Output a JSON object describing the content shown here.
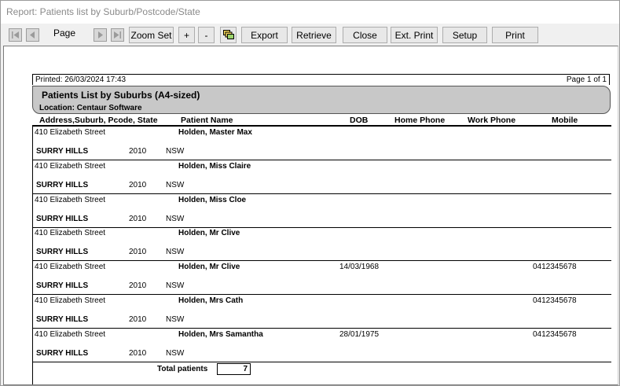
{
  "window": {
    "title": "Report: Patients list by Suburb/Postcode/State"
  },
  "toolbar": {
    "page_label": "Page",
    "zoom_set": "Zoom Set",
    "zoom_in": "+",
    "zoom_out": "-",
    "export": "Export",
    "retrieve": "Retrieve",
    "close": "Close",
    "ext_print": "Ext. Print",
    "setup": "Setup",
    "print": "Print"
  },
  "report": {
    "printed": "Printed: 26/03/2024 17:43",
    "page_of": "Page 1 of 1",
    "title": "Patients List  by  Suburbs (A4-sized)",
    "location": "Location: Centaur Software",
    "columns": {
      "address": "Address,Suburb, Pcode, State",
      "patient": "Patient Name",
      "dob": "DOB",
      "home": "Home Phone",
      "work": "Work Phone",
      "mobile": "Mobile"
    },
    "rows": [
      {
        "address": "410 Elizabeth Street",
        "name": "Holden, Master Max",
        "dob": "",
        "mobile": "",
        "suburb": "SURRY HILLS",
        "pcode": "2010",
        "state": "NSW"
      },
      {
        "address": "410 Elizabeth Street",
        "name": "Holden, Miss Claire",
        "dob": "",
        "mobile": "",
        "suburb": "SURRY HILLS",
        "pcode": "2010",
        "state": "NSW"
      },
      {
        "address": "410 Elizabeth Street",
        "name": "Holden, Miss Cloe",
        "dob": "",
        "mobile": "",
        "suburb": "SURRY HILLS",
        "pcode": "2010",
        "state": "NSW"
      },
      {
        "address": "410 Elizabeth Street",
        "name": "Holden, Mr Clive",
        "dob": "",
        "mobile": "",
        "suburb": "SURRY HILLS",
        "pcode": "2010",
        "state": "NSW"
      },
      {
        "address": "410 Elizabeth Street",
        "name": "Holden, Mr Clive",
        "dob": "14/03/1968",
        "mobile": "0412345678",
        "suburb": "SURRY HILLS",
        "pcode": "2010",
        "state": "NSW"
      },
      {
        "address": "410 Elizabeth Street",
        "name": "Holden, Mrs Cath",
        "dob": "",
        "mobile": "0412345678",
        "suburb": "SURRY HILLS",
        "pcode": "2010",
        "state": "NSW"
      },
      {
        "address": "410 Elizabeth Street",
        "name": "Holden, Mrs Samantha",
        "dob": "28/01/1975",
        "mobile": "0412345678",
        "suburb": "SURRY HILLS",
        "pcode": "2010",
        "state": "NSW"
      }
    ],
    "total_label": "Total patients",
    "total_value": "7"
  }
}
